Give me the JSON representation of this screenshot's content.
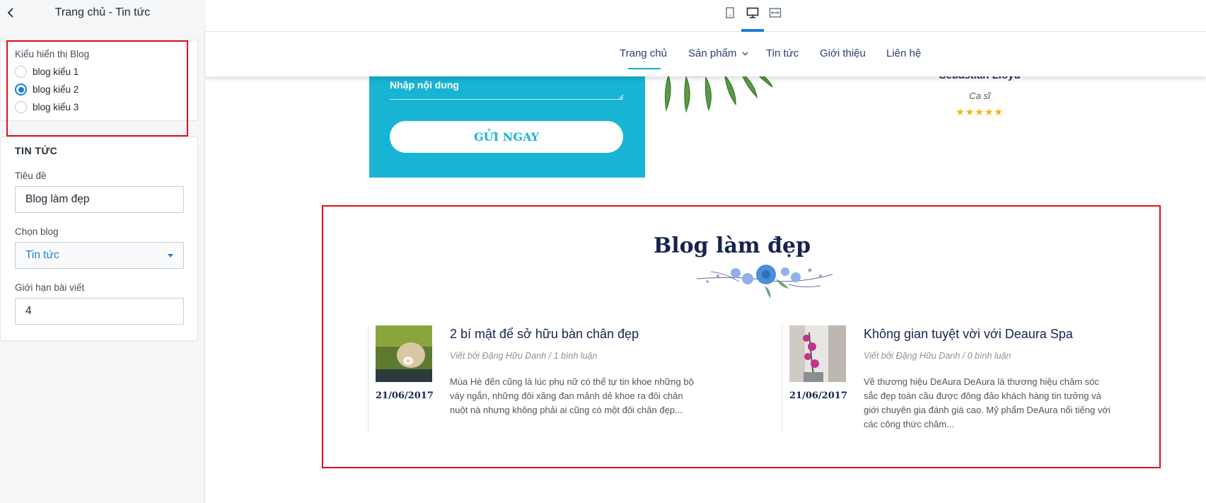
{
  "sidebar": {
    "title": "Trang chủ - Tin tức",
    "blog_style": {
      "label": "Kiểu hiển thị Blog",
      "options": [
        "blog kiểu 1",
        "blog kiểu 2",
        "blog kiểu 3"
      ],
      "selected": "blog kiểu 2"
    },
    "news": {
      "heading": "TIN TỨC",
      "title_label": "Tiêu đề",
      "title_value": "Blog làm đẹp",
      "blog_label": "Chọn blog",
      "blog_value": "Tin tức",
      "limit_label": "Giới hạn bài viết",
      "limit_value": "4"
    }
  },
  "device_bar": {
    "icons": [
      "tablet-icon",
      "desktop-icon",
      "fullwidth-icon"
    ],
    "active": "desktop-icon"
  },
  "nav": {
    "items": [
      "Trang chủ",
      "Sản phẩm",
      "Tin tức",
      "Giới thiệu",
      "Liên hệ"
    ],
    "active": "Trang chủ"
  },
  "contact": {
    "textarea_placeholder": "Nhập nội dung",
    "button": "GỬI NGAY"
  },
  "testimonial": {
    "name": "Sebastian Lloyd",
    "role": "Ca sĩ",
    "rating": 5,
    "stars": "★★★★★"
  },
  "blog": {
    "title": "Blog làm đẹp",
    "posts": [
      {
        "title": "2 bí mật để sở hữu bàn chân đẹp",
        "meta": "Viết bởi Đặng Hữu Danh / 1 bình luận",
        "date": "21/06/2017",
        "excerpt": "Mùa Hè đến cũng là lúc phụ nữ có thể tự tin khoe những bộ váy ngắn, những đôi xăng đan mảnh dẻ khoe ra đôi chân nuột nà nhưng không phải ai cũng có một đôi chân đẹp..."
      },
      {
        "title": "Không gian tuyệt vời với Deaura Spa",
        "meta": "Viết bởi Đặng Hữu Danh / 0 bình luận",
        "date": "21/06/2017",
        "excerpt": "Về thương hiệu DeAura DeAura là thương hiệu chăm sóc sắc đẹp toàn cầu được đông đảo khách hàng tin tưởng và giới chuyên gia đánh giá cao. Mỹ phẩm DeAura nổi tiếng với các công thức chăm..."
      }
    ]
  },
  "colors": {
    "accent": "#1a7fd6",
    "highlight": "#e01018",
    "contact_bg": "#18b4d4",
    "heading": "#15234f"
  }
}
